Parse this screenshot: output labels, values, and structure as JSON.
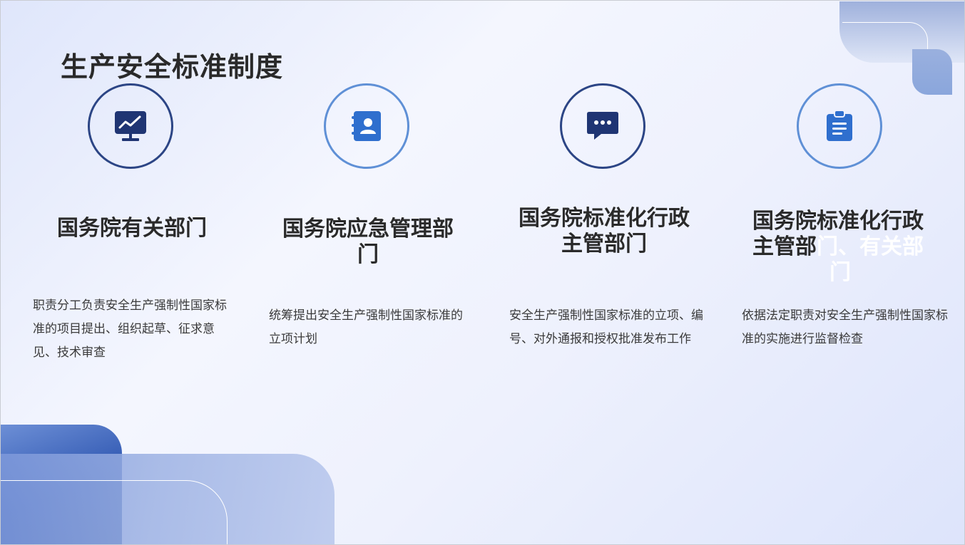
{
  "title": "生产安全标准制度",
  "cards": [
    {
      "icon": "monitor-chart-icon",
      "heading": "国务院有关部门",
      "description": "职责分工负责安全生产强制性国家标准的项目提出、组织起草、征求意见、技术审查"
    },
    {
      "icon": "contact-book-icon",
      "heading_line1": "国务院应急管理部",
      "heading_line2": "门",
      "description": "统筹提出安全生产强制性国家标准的立项计划"
    },
    {
      "icon": "chat-bubble-icon",
      "heading_line1": "国务院标准化行政",
      "heading_line2": "主管部门",
      "description": "安全生产强制性国家标准的立项、编号、对外通报和授权批准发布工作"
    },
    {
      "icon": "clipboard-icon",
      "heading_line1": "国务院标准化行政",
      "heading_line2_dark": "主管部",
      "heading_line2_white": "门、有关部",
      "heading_line3_white": "门",
      "description": "依据法定职责对安全生产强制性国家标准的实施进行监督检查"
    }
  ],
  "colors": {
    "dark_ring": "#2c4585",
    "light_ring": "#5f90d6",
    "icon_dark": "#1f3573",
    "icon_blue": "#2f6fce"
  }
}
